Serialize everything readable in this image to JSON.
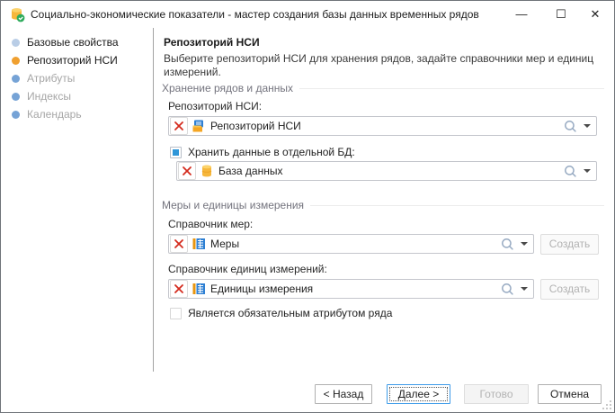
{
  "window": {
    "title": "Социально-экономические показатели - мастер создания базы данных временных рядов",
    "controls": {
      "minimize": "—",
      "maximize": "☐",
      "close": "✕"
    }
  },
  "sidebar": {
    "items": [
      {
        "label": "Базовые свойства",
        "state": "done"
      },
      {
        "label": "Репозиторий НСИ",
        "state": "active"
      },
      {
        "label": "Атрибуты",
        "state": "pending"
      },
      {
        "label": "Индексы",
        "state": "pending"
      },
      {
        "label": "Календарь",
        "state": "pending"
      }
    ]
  },
  "page": {
    "title": "Репозиторий НСИ",
    "description": "Выберите репозиторий НСИ для хранения рядов, задайте справочники мер и единиц измерений.",
    "storage": {
      "caption": "Хранение рядов и данных",
      "repo_label": "Репозиторий НСИ:",
      "repo_value": "Репозиторий НСИ",
      "repo_icon": "repository-icon",
      "separate_db_label": "Хранить данные в отдельной БД:",
      "separate_db_checked": true,
      "db_value": "База данных",
      "db_icon": "database-icon"
    },
    "measures": {
      "caption": "Меры и единицы измерения",
      "measures_label": "Справочник мер:",
      "measures_value": "Меры",
      "measures_icon": "dictionary-icon",
      "units_label": "Справочник единиц измерений:",
      "units_value": "Единицы измерения",
      "units_icon": "dictionary-icon",
      "create_label": "Создать",
      "required_label": "Является обязательным атрибутом ряда",
      "required_checked": false
    }
  },
  "footer": {
    "back": "< Назад",
    "next": "Далее >",
    "finish": "Готово",
    "cancel": "Отмена"
  },
  "colors": {
    "accent_orange": "#f0a030",
    "accent_blue": "#2f96d8",
    "clear_red": "#d42b1e",
    "step_pending_blue": "#76a3d6"
  }
}
